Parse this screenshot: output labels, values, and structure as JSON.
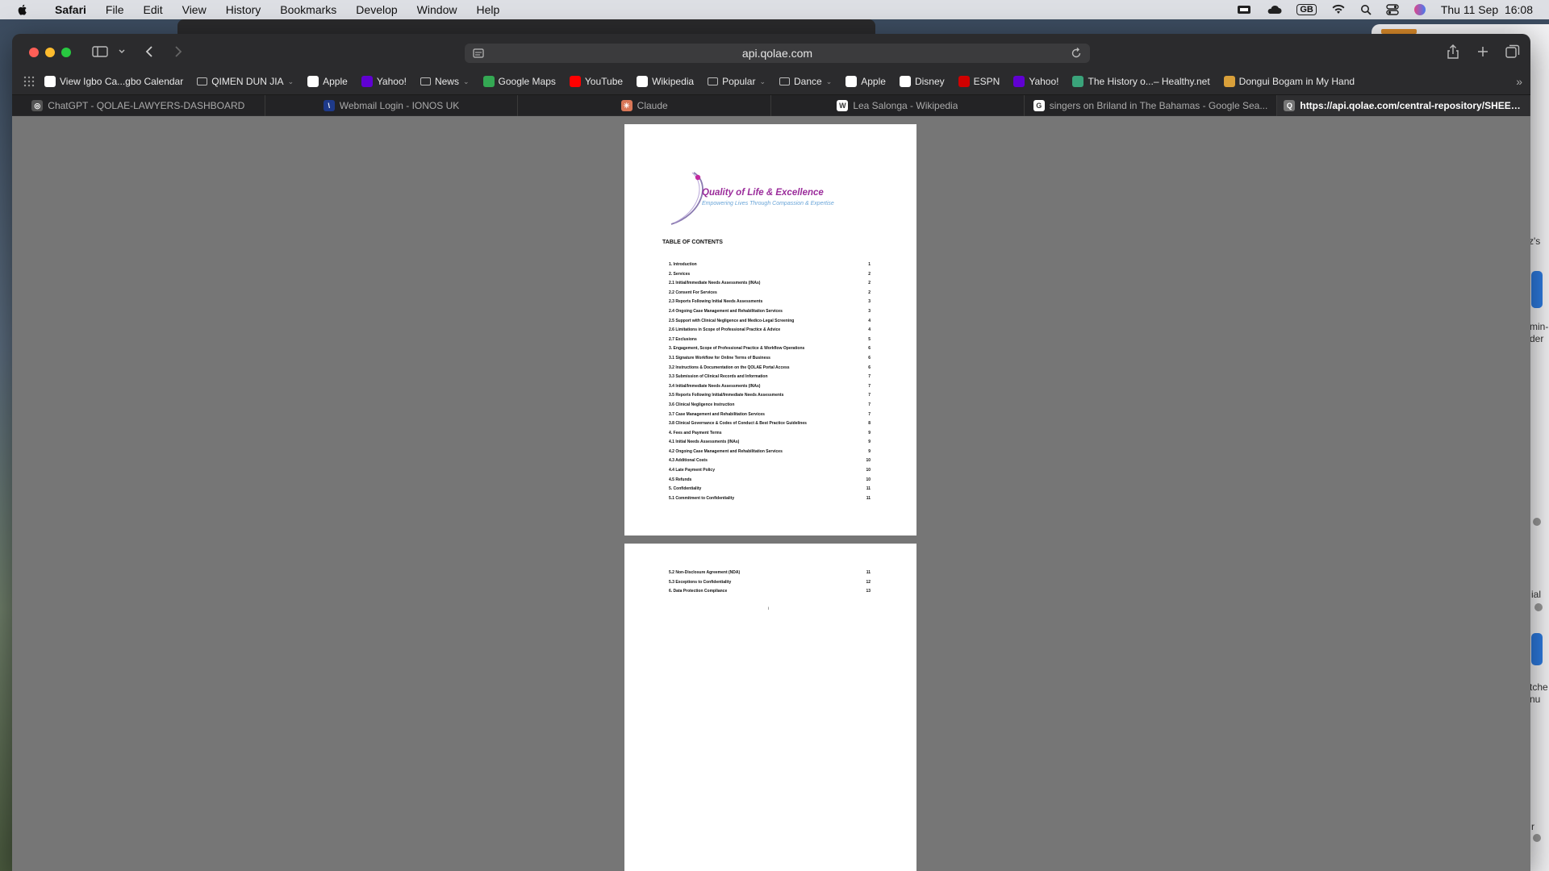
{
  "menubar": {
    "app": "Safari",
    "items": [
      "File",
      "Edit",
      "View",
      "History",
      "Bookmarks",
      "Develop",
      "Window",
      "Help"
    ],
    "keyboard": "GB",
    "datetime": "Thu 11 Sep  16:08"
  },
  "browser": {
    "url": "api.qolae.com",
    "bookmarks": [
      {
        "label": "View Igbo Ca...gbo Calendar",
        "icon": "calendar-icon",
        "color": "#ffffff"
      },
      {
        "label": "QIMEN DUN JIA",
        "icon": "folder-icon",
        "folder": true
      },
      {
        "label": "Apple",
        "icon": "apple-icon",
        "color": "#ffffff"
      },
      {
        "label": "Yahoo!",
        "icon": "yahoo-icon",
        "color": "#6001d2"
      },
      {
        "label": "News",
        "icon": "folder-icon",
        "folder": true
      },
      {
        "label": "Google Maps",
        "icon": "maps-icon",
        "color": "#34a853"
      },
      {
        "label": "YouTube",
        "icon": "youtube-icon",
        "color": "#ff0000"
      },
      {
        "label": "Wikipedia",
        "icon": "wikipedia-icon",
        "color": "#ffffff"
      },
      {
        "label": "Popular",
        "icon": "folder-icon",
        "folder": true
      },
      {
        "label": "Dance",
        "icon": "folder-icon",
        "folder": true
      },
      {
        "label": "Apple",
        "icon": "apple-icon",
        "color": "#ffffff"
      },
      {
        "label": "Disney",
        "icon": "disney-icon",
        "color": "#ffffff"
      },
      {
        "label": "ESPN",
        "icon": "espn-icon",
        "color": "#d00000"
      },
      {
        "label": "Yahoo!",
        "icon": "yahoo-icon",
        "color": "#6001d2"
      },
      {
        "label": "The History o...– Healthy.net",
        "icon": "healthy-icon",
        "color": "#3aa37a"
      },
      {
        "label": "Dongui Bogam in My Hand",
        "icon": "book-icon",
        "color": "#d9a03a"
      }
    ],
    "tabs": [
      {
        "label": "ChatGPT - QOLAE-LAWYERS-DASHBOARD",
        "icon": "chatgpt-icon",
        "color": "#555555",
        "glyph": "◎"
      },
      {
        "label": "Webmail Login - IONOS UK",
        "icon": "ionos-icon",
        "color": "#1e3a8a",
        "glyph": "\\"
      },
      {
        "label": "Claude",
        "icon": "claude-icon",
        "color": "#d97757",
        "glyph": "✳"
      },
      {
        "label": "Lea Salonga - Wikipedia",
        "icon": "wikipedia-icon",
        "color": "#ffffff",
        "glyph": "W"
      },
      {
        "label": "singers on Briland  in The Bahamas - Google Sea...",
        "icon": "google-icon",
        "color": "#ffffff",
        "glyph": "G"
      },
      {
        "label": "https://api.qolae.com/central-repository/SHEET_...",
        "icon": "qolae-icon",
        "color": "#777777",
        "glyph": "Q",
        "active": true
      }
    ]
  },
  "document": {
    "logo_title": "Quality of Life & Excellence",
    "logo_subtitle": "Empowering Lives Through Compassion & Expertise",
    "toc_heading": "TABLE OF CONTENTS",
    "page1_entries": [
      {
        "title": "1. Introduction",
        "page": "1"
      },
      {
        "title": "2. Services",
        "page": "2"
      },
      {
        "title": "2.1 Initial/Immediate Needs Assessments (INAs)",
        "page": "2"
      },
      {
        "title": "2.2 Consent For Services",
        "page": "2"
      },
      {
        "title": "2.3 Reports Following Initial Needs Assessments",
        "page": "3"
      },
      {
        "title": "2.4 Ongoing Case Management and Rehabilitation Services",
        "page": "3"
      },
      {
        "title": "2.5 Support with Clinical Negligence and Medico-Legal Screening",
        "page": "4"
      },
      {
        "title": "2.6 Limitations in Scope of Professional Practice & Advice",
        "page": "4"
      },
      {
        "title": "2.7 Exclusions",
        "page": "5"
      },
      {
        "title": "3. Engagement, Scope of Professional Practice & Workflow Operations",
        "page": "6"
      },
      {
        "title": "3.1 Signature Workflow for Online Terms of Business",
        "page": "6"
      },
      {
        "title": "3.2 Instructions & Documentation on the QOLAE Portal Access",
        "page": "6"
      },
      {
        "title": "3.3 Submission of Clinical Records and Information",
        "page": "7"
      },
      {
        "title": "3.4 Initial/Immediate Needs Assessments (INAs)",
        "page": "7"
      },
      {
        "title": "3.5 Reports Following Initial/Immediate Needs Assessments",
        "page": "7"
      },
      {
        "title": "3.6 Clinical Negligence Instruction",
        "page": "7"
      },
      {
        "title": "3.7 Case Management and Rehabilitation Services",
        "page": "7"
      },
      {
        "title": "3.8 Clinical Governance & Codes of Conduct & Best Practice Guidelines",
        "page": "8"
      },
      {
        "title": "4. Fees and Payment Terms",
        "page": "9"
      },
      {
        "title": "4.1 Initial Needs Assessments (INAs)",
        "page": "9"
      },
      {
        "title": "4.2 Ongoing Case Management and Rehabilitation Services",
        "page": "9"
      },
      {
        "title": "4.3 Additional Costs",
        "page": "10"
      },
      {
        "title": "4.4 Late Payment Policy",
        "page": "10"
      },
      {
        "title": "4.5 Refunds",
        "page": "10"
      },
      {
        "title": "5. Confidentiality",
        "page": "11"
      },
      {
        "title": "5.1 Commitment to Confidentiality",
        "page": "11"
      }
    ],
    "page2_entries": [
      {
        "title": "5.2 Non-Disclosure Agreement (NDA)",
        "page": "11"
      },
      {
        "title": "5.3 Exceptions to Confidentiality",
        "page": "12"
      },
      {
        "title": "6. Data Protection Compliance",
        "page": "13"
      }
    ],
    "page_number": "i"
  },
  "desktop": {
    "side_texts": [
      {
        "text": "z's"
      },
      {
        "text": "min-"
      },
      {
        "text": "der"
      },
      {
        "text": "ial"
      },
      {
        "text": "tche"
      },
      {
        "text": "nu"
      },
      {
        "text": "r"
      }
    ]
  }
}
